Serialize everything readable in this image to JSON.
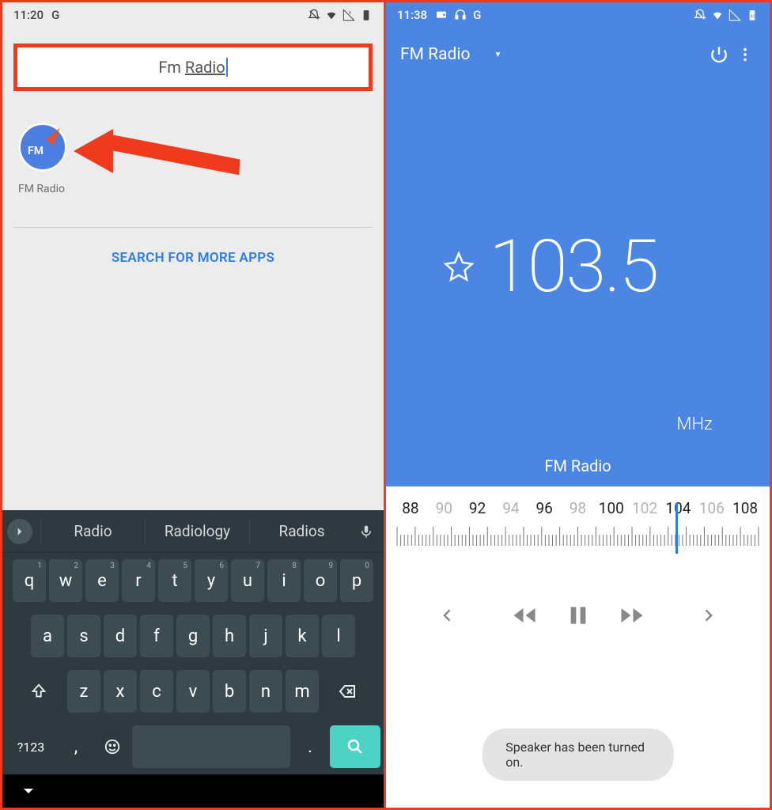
{
  "left": {
    "status": {
      "time": "11:20",
      "apps": [
        "G"
      ]
    },
    "search_value": "Fm Radio",
    "app_result_label": "FM Radio",
    "app_icon_text": "FM",
    "more_apps_label": "SEARCH FOR MORE APPS",
    "suggestions": [
      "Radio",
      "Radiology",
      "Radios"
    ],
    "kbd_row1": [
      [
        "q",
        "1"
      ],
      [
        "w",
        "2"
      ],
      [
        "e",
        "3"
      ],
      [
        "r",
        "4"
      ],
      [
        "t",
        "5"
      ],
      [
        "y",
        "6"
      ],
      [
        "u",
        "7"
      ],
      [
        "i",
        "8"
      ],
      [
        "o",
        "9"
      ],
      [
        "p",
        "0"
      ]
    ],
    "kbd_row2": [
      "a",
      "s",
      "d",
      "f",
      "g",
      "h",
      "j",
      "k",
      "l"
    ],
    "kbd_row3": [
      "z",
      "x",
      "c",
      "v",
      "b",
      "n",
      "m"
    ],
    "symkey": "?123",
    "comma": ",",
    "period": "."
  },
  "right": {
    "status": {
      "time": "11:38"
    },
    "appbar_title": "FM Radio",
    "frequency": "103.5",
    "unit": "MHz",
    "station_name": "FM Radio",
    "dial_labels": [
      {
        "v": "88",
        "on": true
      },
      {
        "v": "90",
        "on": false
      },
      {
        "v": "92",
        "on": true
      },
      {
        "v": "94",
        "on": false
      },
      {
        "v": "96",
        "on": true
      },
      {
        "v": "98",
        "on": false
      },
      {
        "v": "100",
        "on": true
      },
      {
        "v": "102",
        "on": false
      },
      {
        "v": "104",
        "on": true
      },
      {
        "v": "106",
        "on": false
      },
      {
        "v": "108",
        "on": true
      }
    ],
    "toast": "Speaker has been turned on."
  }
}
